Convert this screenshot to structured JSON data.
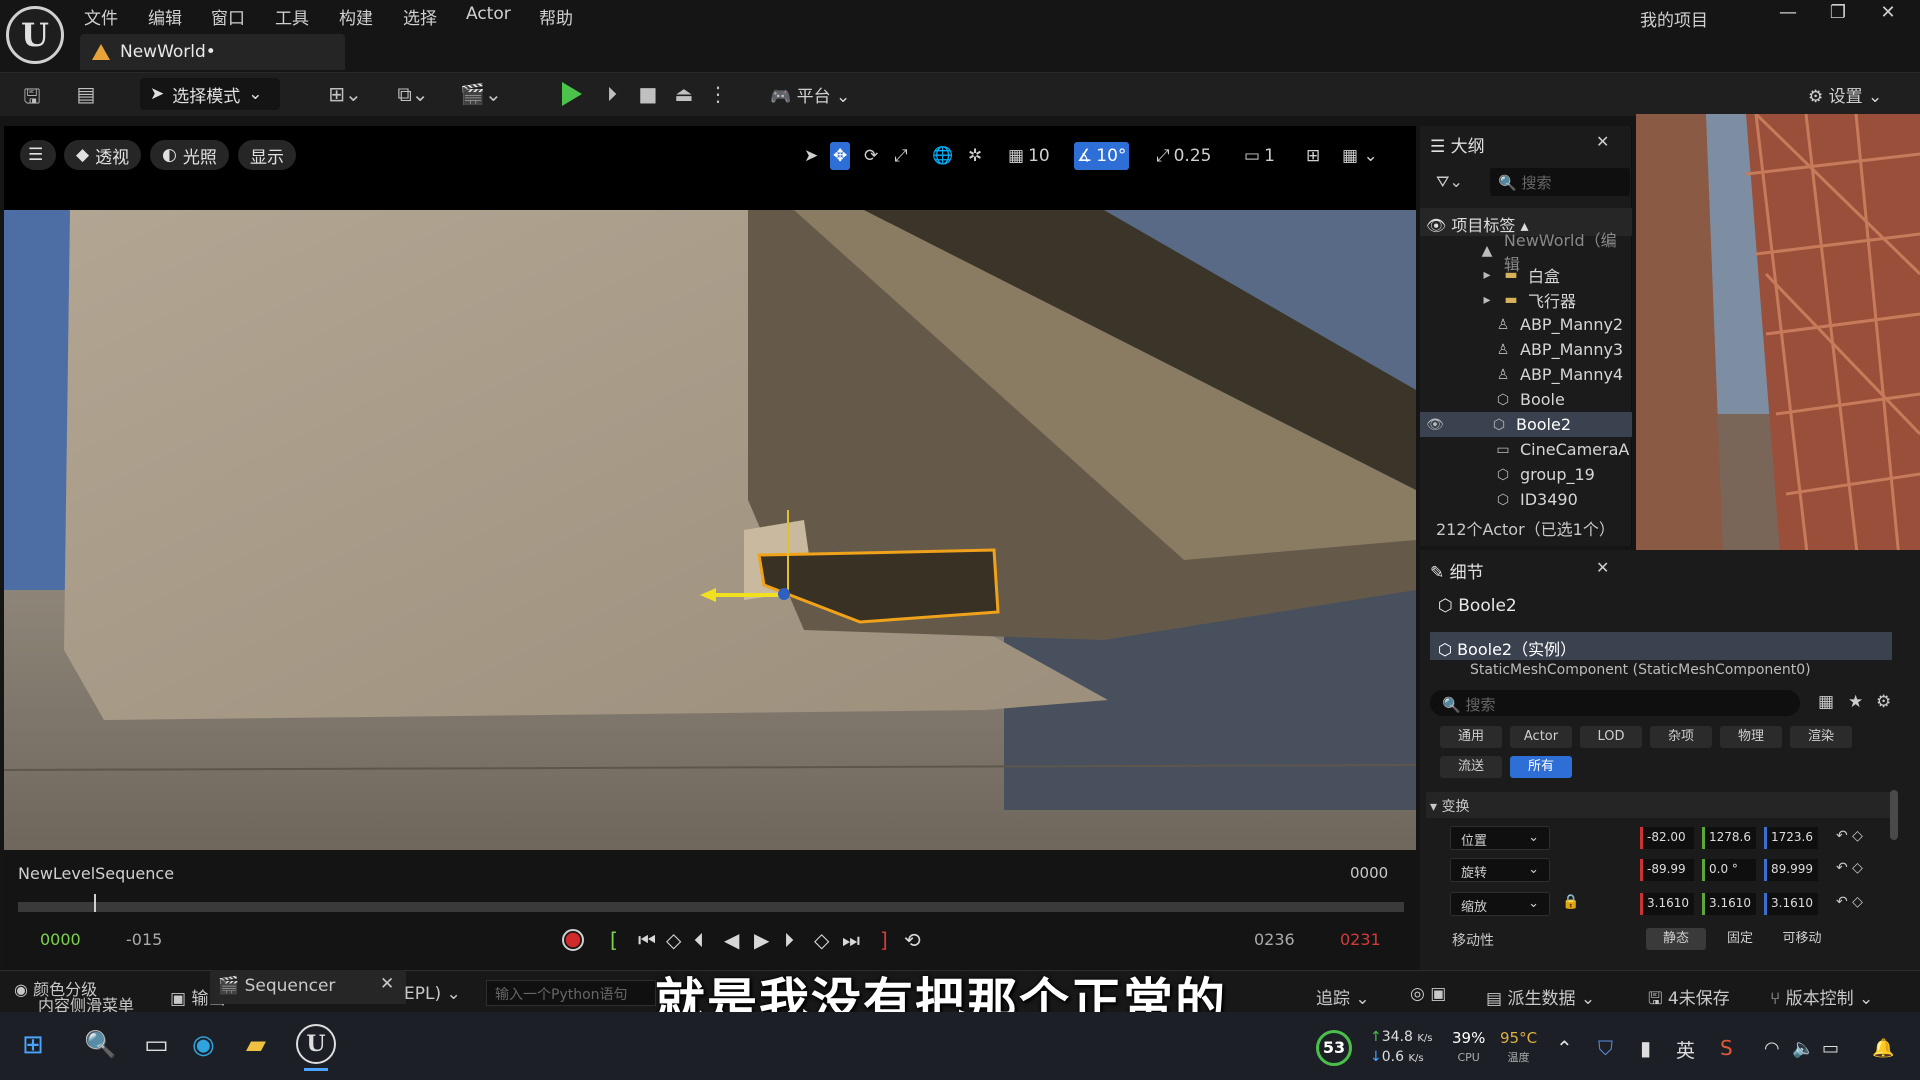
{
  "app": {
    "logo": "U",
    "project": "我的项目",
    "tab_title": "NewWorld•"
  },
  "menu": [
    "文件",
    "编辑",
    "窗口",
    "工具",
    "构建",
    "选择",
    "Actor",
    "帮助"
  ],
  "toolbar": {
    "select_mode": "选择模式",
    "platform": "平台",
    "settings": "设置"
  },
  "viewport_bar": {
    "perspective": "透视",
    "lighting": "光照",
    "show": "显示",
    "grid_snap": "10",
    "rot_snap": "10°",
    "scale_snap": "0.25",
    "camera_speed": "1"
  },
  "sequencer": {
    "title": "NewLevelSequence",
    "current_right": "0000",
    "start": "0000",
    "neg": "-015",
    "end": "0236",
    "end_red": "0231"
  },
  "bottom": {
    "content_browser": "内容侧滑菜单",
    "output": "输出",
    "sequencer_tab": "Sequencer",
    "color_grading": "颜色分级",
    "cmd_mode": "EPL)",
    "python_placeholder": "输入一个Python语句",
    "trace": "追踪",
    "derived_data": "派生数据",
    "unsaved": "4未保存",
    "source_control": "版本控制"
  },
  "subtitle": "就是我没有把那个正常的",
  "outliner": {
    "title": "大纲",
    "search_placeholder": "搜索",
    "label_header": "项目标签",
    "rows": [
      "NewWorld（编辑",
      "白盒",
      "飞行器",
      "ABP_Manny2",
      "ABP_Manny3",
      "ABP_Manny4",
      "Boole",
      "Boole2",
      "CineCameraA",
      "group_19",
      "ID3490"
    ],
    "count": "212个Actor（已选1个）"
  },
  "details": {
    "title": "细节",
    "object": "Boole2",
    "instance": "Boole2（实例）",
    "component": "StaticMeshComponent (StaticMeshComponent0)",
    "search_placeholder": "搜索",
    "chips_row1": [
      "通用",
      "Actor",
      "LOD",
      "杂项",
      "物理",
      "渲染"
    ],
    "chips_row2": [
      "流送",
      "所有"
    ],
    "section": "变换",
    "location_label": "位置",
    "rotation_label": "旋转",
    "scale_label": "缩放",
    "location": [
      "-82.00",
      "1278.6",
      "1723.6"
    ],
    "rotation": [
      "-89.99",
      "0.0 °",
      "89.999"
    ],
    "scale": [
      "3.1610",
      "3.1610",
      "3.1610"
    ],
    "mobility_label": "移动性",
    "mobility": [
      "静态",
      "固定",
      "可移动"
    ]
  },
  "taskbar": {
    "badge": "53",
    "net_up": "34.8",
    "net_down": "0.6",
    "net_unit": "K/s",
    "cpu": "39%",
    "cpu_label": "CPU",
    "temp": "95°C",
    "temp_label": "温度",
    "ime": "英"
  },
  "colors": {
    "accent": "#2d6fd6",
    "play": "#4cc44c",
    "rec": "#d02a2a"
  }
}
